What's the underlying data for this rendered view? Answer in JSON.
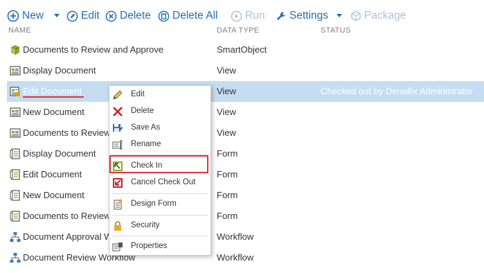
{
  "toolbar": {
    "new_label": "New",
    "edit_label": "Edit",
    "delete_label": "Delete",
    "delete_all_label": "Delete All",
    "run_label": "Run",
    "settings_label": "Settings",
    "package_label": "Package"
  },
  "columns": {
    "name": "NAME",
    "type": "DATA TYPE",
    "status": "STATUS"
  },
  "rows": [
    {
      "name": "Documents to Review and Approve",
      "type": "SmartObject",
      "status": "",
      "icon": "smartobject-icon"
    },
    {
      "name": "Display Document",
      "type": "View",
      "status": "",
      "icon": "view-icon"
    },
    {
      "name": "Edit Document",
      "type": "View",
      "status": "Checked out by Denallix Administrator",
      "icon": "view-checked-out-icon"
    },
    {
      "name": "New Document",
      "type": "View",
      "status": "",
      "icon": "view-icon"
    },
    {
      "name": "Documents to Review",
      "type": "View",
      "status": "",
      "icon": "view-icon"
    },
    {
      "name": "Display Document",
      "type": "Form",
      "status": "",
      "icon": "form-icon"
    },
    {
      "name": "Edit Document",
      "type": "Form",
      "status": "",
      "icon": "form-icon"
    },
    {
      "name": "New Document",
      "type": "Form",
      "status": "",
      "icon": "form-icon"
    },
    {
      "name": "Documents to Review",
      "type": "Form",
      "status": "",
      "icon": "form-icon"
    },
    {
      "name": "Document Approval W",
      "type": "Workflow",
      "status": "",
      "icon": "workflow-icon"
    },
    {
      "name": "Document Review Workflow",
      "type": "Workflow",
      "status": "",
      "icon": "workflow-icon"
    }
  ],
  "menu": {
    "edit": "Edit",
    "delete": "Delete",
    "save_as": "Save As",
    "rename": "Rename",
    "check_in": "Check In",
    "cancel_check_out": "Cancel Check Out",
    "design_form": "Design Form",
    "security": "Security",
    "properties": "Properties"
  },
  "colors": {
    "accent": "#1f6fb5",
    "selected_row": "#c5ddf2",
    "highlight": "#e0313f"
  }
}
